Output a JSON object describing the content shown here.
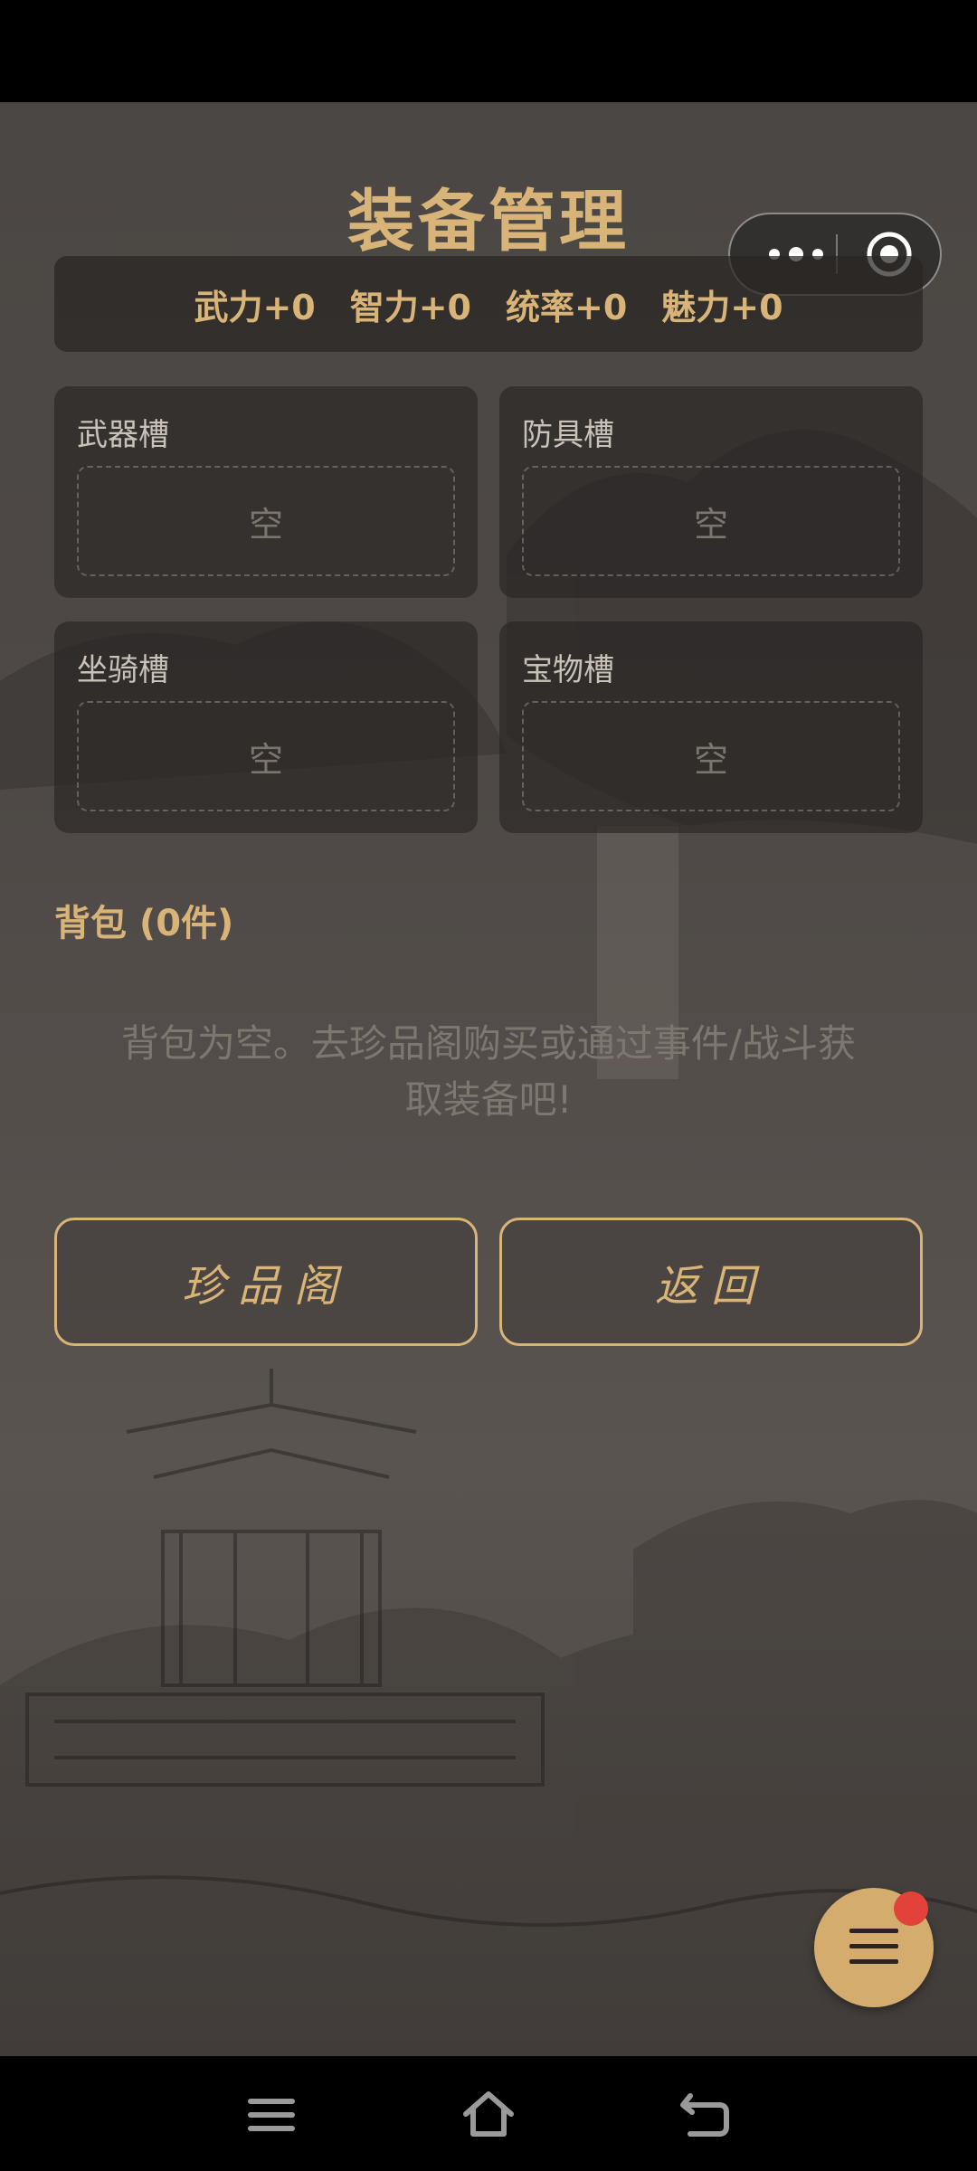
{
  "page": {
    "title": "装备管理"
  },
  "capsule": {
    "more_icon": "more-dots-icon",
    "close_icon": "target-icon"
  },
  "stats": {
    "strength": "武力+0",
    "intelligence": "智力+0",
    "command": "统率+0",
    "charm": "魅力+0"
  },
  "slots": [
    {
      "label": "武器槽",
      "value": "空"
    },
    {
      "label": "防具槽",
      "value": "空"
    },
    {
      "label": "坐骑槽",
      "value": "空"
    },
    {
      "label": "宝物槽",
      "value": "空"
    }
  ],
  "backpack": {
    "title": "背包 (0件)",
    "empty_line1": "背包为空。去珍品阁购买或通过事件/战斗获",
    "empty_line2": "取装备吧!"
  },
  "buttons": {
    "shop": "珍品阁",
    "back": "返回"
  },
  "fab": {
    "icon": "menu-icon",
    "badge_color": "#e2423a"
  },
  "colors": {
    "accent_gold": "#d8b479",
    "background": "#4b4744"
  }
}
